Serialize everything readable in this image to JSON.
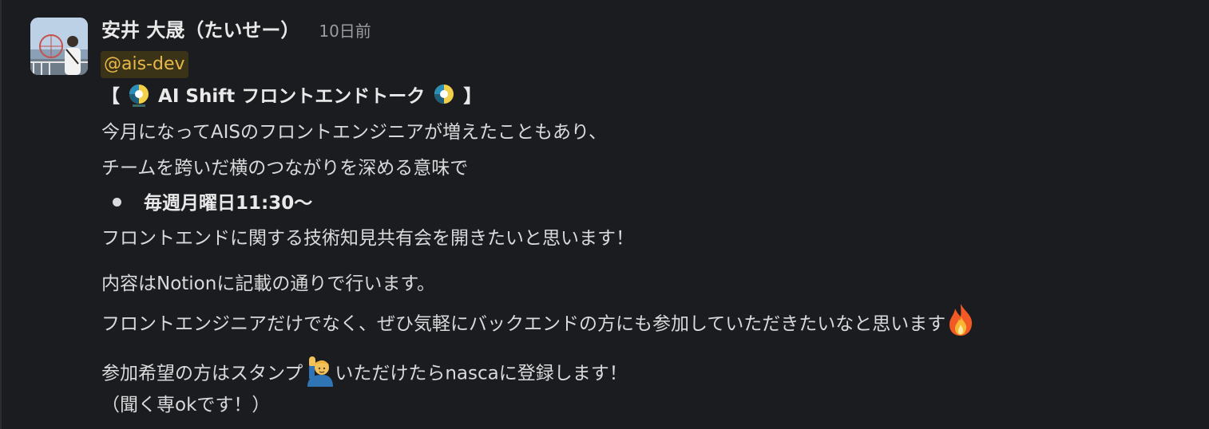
{
  "message": {
    "sender_name": "安井 大晟（たいせー）",
    "timestamp": "10日前",
    "mention": "@ais-dev",
    "title_open": "【",
    "title_text": "AI Shift フロントエンドトーク",
    "title_close": "】",
    "title_emoji": "aishift-logo-icon",
    "line1": "今月になってAISのフロントエンジニアが増えたこともあり、",
    "line2": "チームを跨いだ横のつながりを深める意味で",
    "bullet": "毎週月曜日11:30〜",
    "line3": "フロントエンドに関する技術知見共有会を開きたいと思います！",
    "line4": "内容はNotionに記載の通りで行います。",
    "line5": "フロントエンジニアだけでなく、ぜひ気軽にバックエンドの方にも参加していただきたいなと思います",
    "line6_before": "参加希望の方はスタンプ",
    "line6_after": "いただけたらnascaに登録します！",
    "line7": "（聞く専okです！）"
  },
  "icons": {
    "fire": "fire-icon",
    "raising_hand": "person-raising-hand-icon"
  },
  "colors": {
    "background": "#1b1c1f",
    "mention_bg": "#3b3317",
    "mention_text": "#e7b94a",
    "text": "#d9dadb",
    "muted": "#9b9c9f"
  }
}
